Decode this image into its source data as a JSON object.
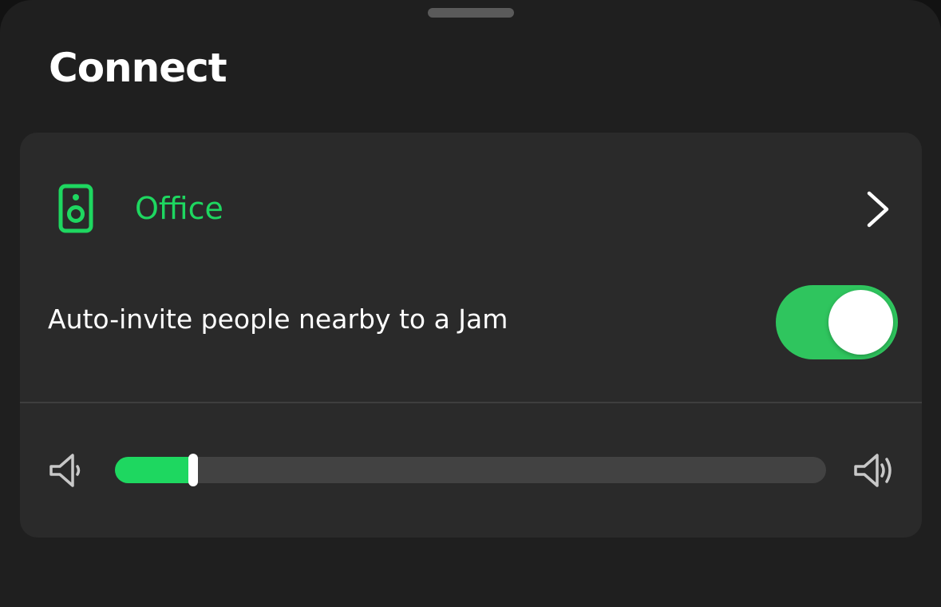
{
  "sheet": {
    "title": "Connect"
  },
  "device": {
    "name": "Office",
    "icon": "speaker-icon",
    "trailing_icon": "chevron-right-icon"
  },
  "jam": {
    "label": "Auto-invite people nearby to a Jam",
    "enabled": true
  },
  "volume": {
    "level": 0.11,
    "low_icon": "volume-low-icon",
    "high_icon": "volume-high-icon"
  },
  "colors": {
    "accent": "#1ed760",
    "toggle_on": "#2fc55e",
    "background": "#1f1f1f",
    "card": "#2a2a2a"
  }
}
